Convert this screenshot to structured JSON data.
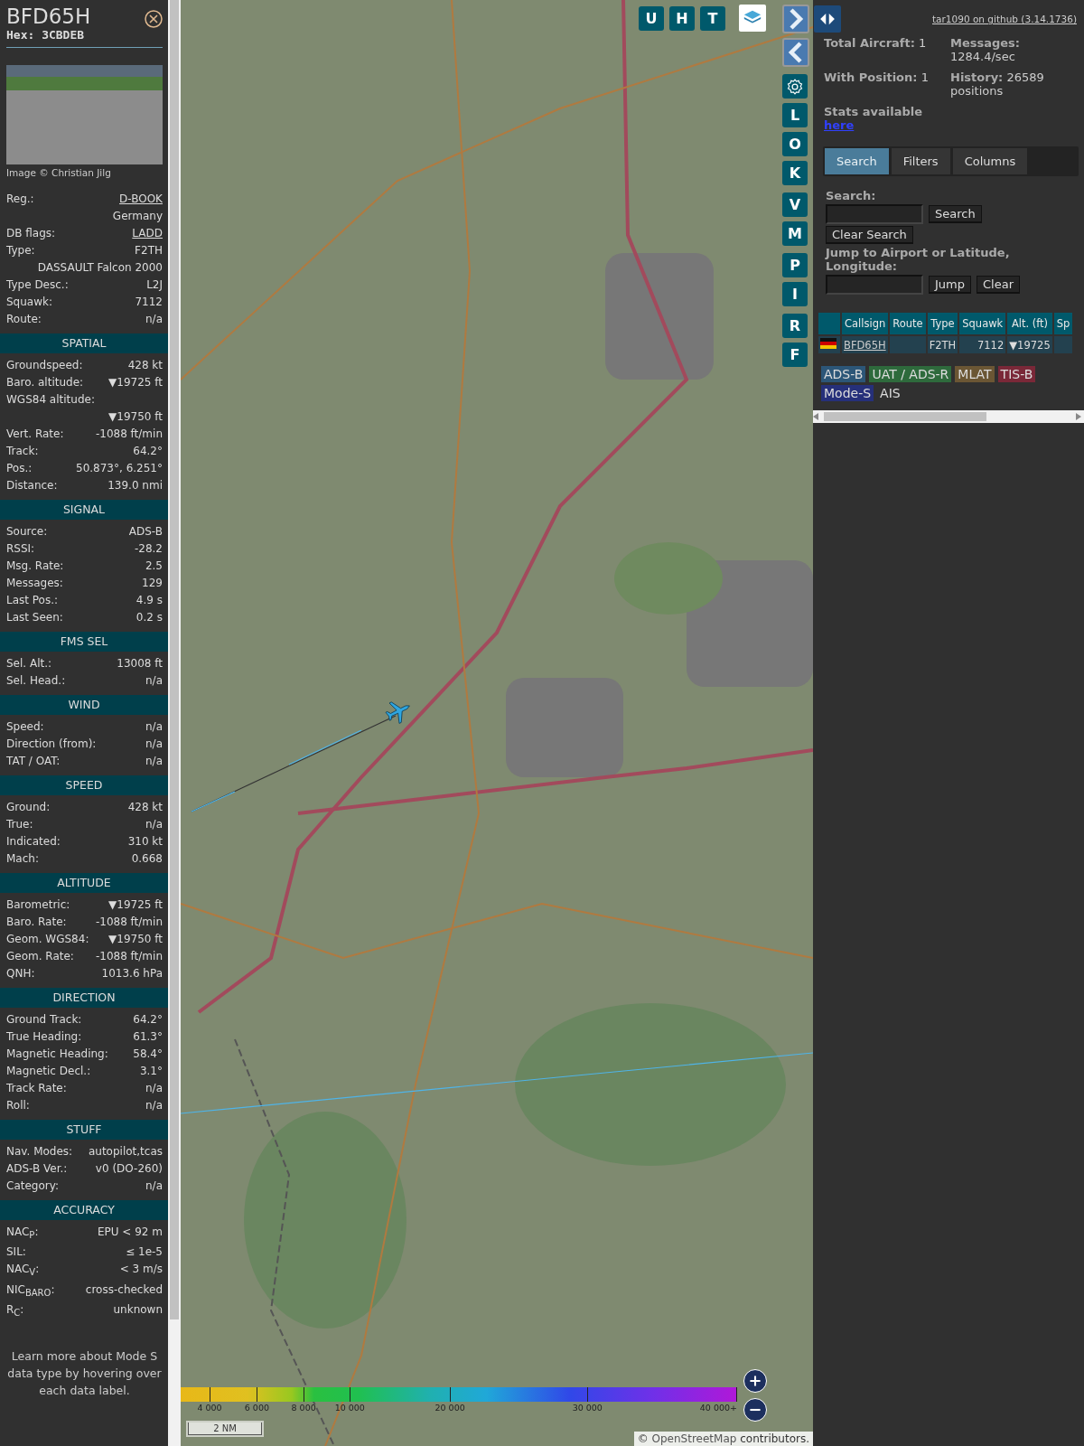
{
  "selected_aircraft": {
    "callsign": "BFD65H",
    "hex": "Hex: 3CBDEB",
    "photo_credit": "Image © Christian Jilg",
    "rows": [
      {
        "kind": "link",
        "label": "Reg.:",
        "value": "D-BOOK"
      },
      {
        "kind": "value",
        "value": "Germany"
      },
      {
        "kind": "link",
        "label": "DB flags:",
        "value": "LADD"
      },
      {
        "kind": "pair",
        "label": "Type:",
        "value": "F2TH"
      },
      {
        "kind": "value",
        "value": "DASSAULT Falcon 2000"
      },
      {
        "kind": "pair",
        "label": "Type Desc.:",
        "value": "L2J"
      },
      {
        "kind": "pair",
        "label": "Squawk:",
        "value": "7112"
      },
      {
        "kind": "pair",
        "label": "Route:",
        "value": "n/a"
      }
    ],
    "sections": [
      {
        "title": "SPATIAL",
        "rows": [
          {
            "kind": "pair",
            "label": "Groundspeed:",
            "value": "428 kt"
          },
          {
            "kind": "pair",
            "label": "Baro. altitude:",
            "value": "▼19725 ft"
          },
          {
            "kind": "label",
            "label": "WGS84 altitude:"
          },
          {
            "kind": "value",
            "value": "▼19750 ft"
          },
          {
            "kind": "pair",
            "label": "Vert. Rate:",
            "value": "-1088 ft/min"
          },
          {
            "kind": "pair",
            "label": "Track:",
            "value": "64.2°"
          },
          {
            "kind": "pair",
            "label": "Pos.:",
            "value": "50.873°, 6.251°"
          },
          {
            "kind": "pair",
            "label": "Distance:",
            "value": "139.0 nmi"
          }
        ]
      },
      {
        "title": "SIGNAL",
        "rows": [
          {
            "kind": "pair",
            "label": "Source:",
            "value": "ADS-B"
          },
          {
            "kind": "pair",
            "label": "RSSI:",
            "value": "-28.2"
          },
          {
            "kind": "pair",
            "label": "Msg. Rate:",
            "value": "2.5"
          },
          {
            "kind": "pair",
            "label": "Messages:",
            "value": "129"
          },
          {
            "kind": "pair",
            "label": "Last Pos.:",
            "value": "4.9 s"
          },
          {
            "kind": "pair",
            "label": "Last Seen:",
            "value": "0.2 s"
          }
        ]
      },
      {
        "title": "FMS SEL",
        "rows": [
          {
            "kind": "pair",
            "label": "Sel. Alt.:",
            "value": "13008 ft"
          },
          {
            "kind": "pair",
            "label": "Sel. Head.:",
            "value": "n/a"
          }
        ]
      },
      {
        "title": "WIND",
        "rows": [
          {
            "kind": "pair",
            "label": "Speed:",
            "value": "n/a"
          },
          {
            "kind": "pair",
            "label": "Direction (from):",
            "value": "n/a"
          },
          {
            "kind": "pair",
            "label": "TAT / OAT:",
            "value": "n/a"
          }
        ]
      },
      {
        "title": "SPEED",
        "rows": [
          {
            "kind": "pair",
            "label": "Ground:",
            "value": "428 kt"
          },
          {
            "kind": "pair",
            "label": "True:",
            "value": "n/a"
          },
          {
            "kind": "pair",
            "label": "Indicated:",
            "value": "310 kt"
          },
          {
            "kind": "pair",
            "label": "Mach:",
            "value": "0.668"
          }
        ]
      },
      {
        "title": "ALTITUDE",
        "rows": [
          {
            "kind": "pair",
            "label": "Barometric:",
            "value": "▼19725 ft"
          },
          {
            "kind": "pair",
            "label": "Baro. Rate:",
            "value": "-1088 ft/min"
          },
          {
            "kind": "pair",
            "label": "Geom. WGS84:",
            "value": "▼19750 ft"
          },
          {
            "kind": "pair",
            "label": "Geom. Rate:",
            "value": "-1088 ft/min"
          },
          {
            "kind": "pair",
            "label": "QNH:",
            "value": "1013.6 hPa"
          }
        ]
      },
      {
        "title": "DIRECTION",
        "rows": [
          {
            "kind": "pair",
            "label": "Ground Track:",
            "value": "64.2°"
          },
          {
            "kind": "pair",
            "label": "True Heading:",
            "value": "61.3°"
          },
          {
            "kind": "pair",
            "label": "Magnetic Heading:",
            "value": "58.4°"
          },
          {
            "kind": "pair",
            "label": "Magnetic Decl.:",
            "value": "3.1°"
          },
          {
            "kind": "pair",
            "label": "Track Rate:",
            "value": "n/a"
          },
          {
            "kind": "pair",
            "label": "Roll:",
            "value": "n/a"
          }
        ]
      },
      {
        "title": "STUFF",
        "rows": [
          {
            "kind": "pair",
            "label": "Nav. Modes:",
            "value": "autopilot,tcas"
          },
          {
            "kind": "pair",
            "label": "ADS-B Ver.:",
            "value": "v0 (DO-260)"
          },
          {
            "kind": "pair",
            "label": "Category:",
            "value": "n/a"
          }
        ]
      },
      {
        "title": "ACCURACY",
        "rows": [
          {
            "kind": "pair",
            "label": "NAC$_{P}$:",
            "value": "EPU < 92 m"
          },
          {
            "kind": "pair",
            "label": "SIL:",
            "value": "≤ 1e-5"
          },
          {
            "kind": "pair",
            "label": "NAC$_{V}$:",
            "value": "< 3 m/s"
          },
          {
            "kind": "pair",
            "label": "NIC$_{BARO}$:",
            "value": "cross-checked"
          },
          {
            "kind": "pair",
            "label": "R$_{C}$:",
            "value": "unknown"
          }
        ]
      }
    ],
    "footnote": "Learn more about Mode S data type by hovering over each data label."
  },
  "map": {
    "top_buttons": [
      "U",
      "H",
      "T"
    ],
    "side_buttons": [
      {
        "kind": "next"
      },
      {
        "kind": "prev"
      },
      {
        "kind": "settings"
      },
      {
        "kind": "letter",
        "label": "L"
      },
      {
        "kind": "letter",
        "label": "O"
      },
      {
        "kind": "letter",
        "label": "K"
      },
      {
        "kind": "letter",
        "label": "V"
      },
      {
        "kind": "letter",
        "label": "M"
      },
      {
        "kind": "letter",
        "label": "P"
      },
      {
        "kind": "letter",
        "label": "I"
      },
      {
        "kind": "letter",
        "label": "R"
      },
      {
        "kind": "letter",
        "label": "F"
      }
    ],
    "altitude_scale": [
      "4 000",
      "6 000",
      "8 000",
      "10 000",
      "20 000",
      "30 000",
      "40 000+"
    ],
    "scale_bar": "2 NM",
    "attribution_prefix": "©",
    "attribution_link": "OpenStreetMap",
    "attribution_suffix": "contributors."
  },
  "panel": {
    "github_link": "tar1090 on github (3.14.1736)",
    "stats": [
      {
        "label": "Total Aircraft:",
        "value": "1"
      },
      {
        "label": "Messages:",
        "value": "1284.4/sec"
      },
      {
        "label": "With Position:",
        "value": "1"
      },
      {
        "label": "History:",
        "value": "26589 positions"
      }
    ],
    "stats_note": "Stats available",
    "stats_link": "here",
    "tabs": [
      {
        "label": "Search",
        "selected": true
      },
      {
        "label": "Filters",
        "selected": false
      },
      {
        "label": "Columns",
        "selected": false
      }
    ],
    "search_label": "Search:",
    "search_button": "Search",
    "clear_search_button": "Clear Search",
    "jump_label": "Jump to Airport or Latitude, Longitude:",
    "jump_button": "Jump",
    "clear_button": "Clear",
    "table": {
      "columns": [
        "Callsign",
        "Route",
        "Type",
        "Squawk",
        "Alt. (ft)",
        "Sp"
      ],
      "rows": [
        {
          "callsign": "BFD65H",
          "type": "F2TH",
          "squawk": "7112",
          "altitude": "▼19725"
        }
      ]
    },
    "legend": [
      {
        "label": "ADS-B",
        "color": "#2c5678"
      },
      {
        "label": "UAT / ADS-R",
        "color": "#2e6a3c"
      },
      {
        "label": "MLAT",
        "color": "#6b5634"
      },
      {
        "label": "TIS-B",
        "color": "#7a2838"
      },
      {
        "label": "Mode-S",
        "color": "#26307a"
      },
      {
        "label": "AIS",
        "color": "#303030"
      }
    ]
  }
}
